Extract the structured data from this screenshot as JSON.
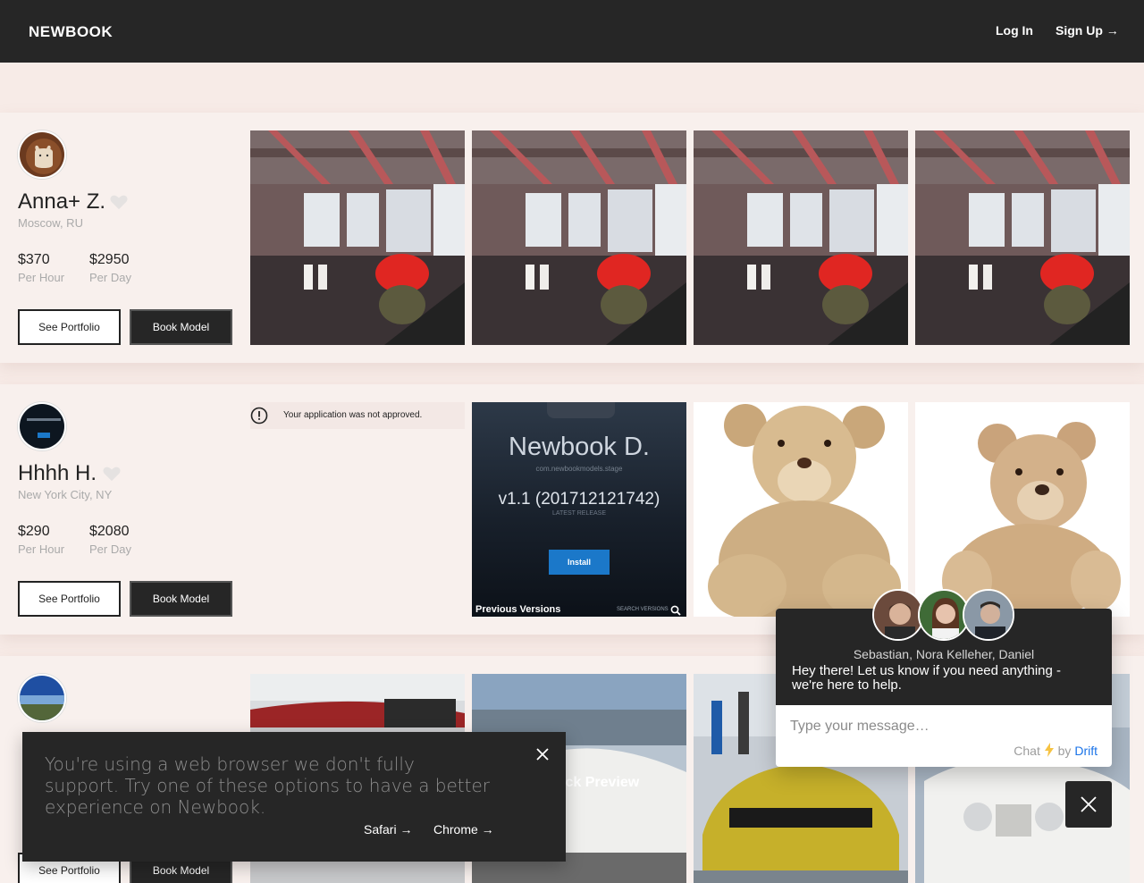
{
  "header": {
    "logo": "NEWBOOK",
    "login_label": "Log In",
    "signup_label": "Sign Up →"
  },
  "models": [
    {
      "name": "Anna+ Z.",
      "location": "Moscow, RU",
      "hour_price": "$370",
      "hour_unit": "Per Hour",
      "day_price": "$2950",
      "day_unit": "Per Day",
      "portfolio_label": "See Portfolio",
      "book_label": "Book Model"
    },
    {
      "name": "Hhhh H.",
      "location": "New York City, NY",
      "hour_price": "$290",
      "hour_unit": "Per Hour",
      "day_price": "$2080",
      "day_unit": "Per Day",
      "portfolio_label": "See Portfolio",
      "book_label": "Book Model",
      "alert": "Your application was not approved."
    },
    {
      "portfolio_label": "See Portfolio",
      "book_label": "Book Model"
    }
  ],
  "app_screenshot": {
    "title": "Newbook D.",
    "subtitle": "com.newbookmodels.stage",
    "version": "v1.1 (201712121742)",
    "latest": "LATEST RELEASE",
    "install": "Install",
    "previous": "Previous Versions",
    "search": "SEARCH VERSIONS"
  },
  "photo_overlay": "ick Preview",
  "chat": {
    "agents": "Sebastian, Nora Kelleher, Daniel",
    "message": "Hey there! Let us know if you need anything - we're here to help.",
    "placeholder": "Type your message…",
    "powered_chat": "Chat",
    "powered_by": "by",
    "powered_drift": "Drift"
  },
  "browser_banner": {
    "text": "You're using a web browser we don't fully support. Try one of these options to have a better experience on Newbook.",
    "safari": "Safari →",
    "chrome": "Chrome →"
  },
  "colors": {
    "header_bg": "#262626",
    "page_bg": "#f7ebe7",
    "card_bg": "#f8f0ed",
    "drift_blue": "#1a73e8",
    "install_blue": "#1b78c9"
  }
}
